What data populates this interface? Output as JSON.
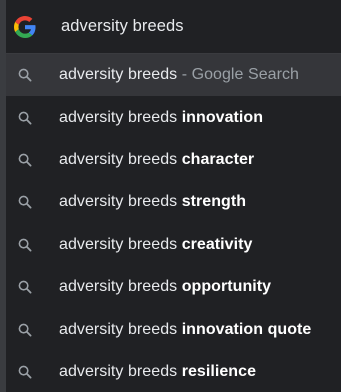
{
  "omnibox": {
    "icon": "google-g-icon",
    "text": "adversity breeds"
  },
  "suggestions": [
    {
      "icon": "search-icon",
      "prefix": "adversity breeds",
      "bold": "",
      "separator": " - ",
      "secondary": "Google Search",
      "selected": true
    },
    {
      "icon": "search-icon",
      "prefix": "adversity breeds ",
      "bold": "innovation",
      "selected": false
    },
    {
      "icon": "search-icon",
      "prefix": "adversity breeds ",
      "bold": "character",
      "selected": false
    },
    {
      "icon": "search-icon",
      "prefix": "adversity breeds ",
      "bold": "strength",
      "selected": false
    },
    {
      "icon": "search-icon",
      "prefix": "adversity breeds ",
      "bold": "creativity",
      "selected": false
    },
    {
      "icon": "search-icon",
      "prefix": "adversity breeds ",
      "bold": "opportunity",
      "selected": false
    },
    {
      "icon": "search-icon",
      "prefix": "adversity breeds ",
      "bold": "innovation quote",
      "selected": false
    },
    {
      "icon": "search-icon",
      "prefix": "adversity breeds ",
      "bold": "resilience",
      "selected": false
    }
  ],
  "colors": {
    "background": "#202124",
    "selected_row": "#35363a",
    "text": "#e8eaed",
    "secondary_text": "#9aa0a6"
  }
}
